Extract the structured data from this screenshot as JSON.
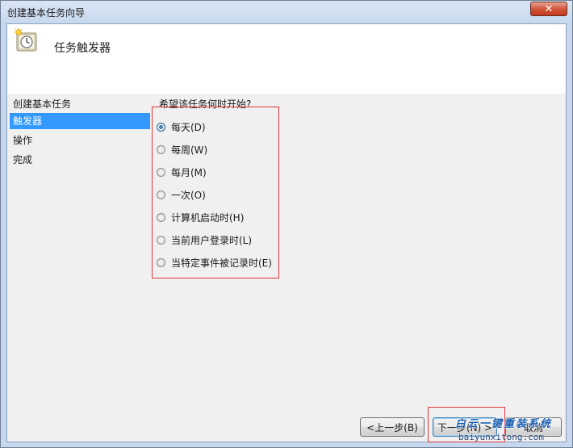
{
  "window": {
    "title": "创建基本任务向导",
    "close_icon": "close-icon"
  },
  "header": {
    "title": "任务触发器",
    "icon": "task-clock-icon"
  },
  "nav": {
    "items": [
      {
        "label": "创建基本任务",
        "selected": false
      },
      {
        "label": "触发器",
        "selected": true
      },
      {
        "label": "操作",
        "selected": false
      },
      {
        "label": "完成",
        "selected": false
      }
    ]
  },
  "main": {
    "question": "希望该任务何时开始?",
    "options": [
      {
        "label": "每天(D)",
        "checked": true
      },
      {
        "label": "每周(W)",
        "checked": false
      },
      {
        "label": "每月(M)",
        "checked": false
      },
      {
        "label": "一次(O)",
        "checked": false
      },
      {
        "label": "计算机启动时(H)",
        "checked": false
      },
      {
        "label": "当前用户登录时(L)",
        "checked": false
      },
      {
        "label": "当特定事件被记录时(E)",
        "checked": false
      }
    ]
  },
  "buttons": {
    "back": "<上一步(B)",
    "next": "下一步(N) >",
    "cancel": "取消"
  },
  "watermark": {
    "text": "白云一键重装系统",
    "url": "baiyunxitong.com"
  },
  "colors": {
    "selection": "#3399ff",
    "highlight_box": "#e03a3a",
    "title_bar": "#c7d8ee"
  }
}
